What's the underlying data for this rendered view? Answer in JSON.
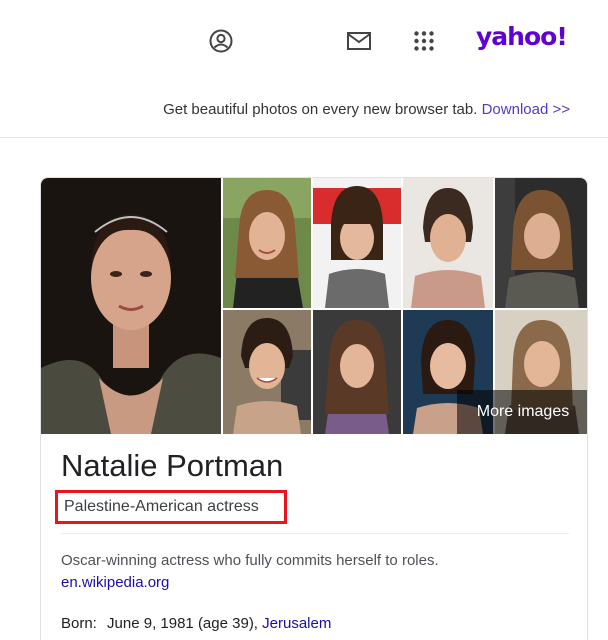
{
  "header": {
    "profile_icon": "profile-icon",
    "mail_icon": "mail-icon",
    "apps_icon": "apps-grid-icon",
    "logo_text": "yahoo!"
  },
  "promo": {
    "text": "Get beautiful photos on every new browser tab.",
    "link": "Download >>"
  },
  "knowledge_panel": {
    "more_images_label": "More images",
    "title": "Natalie Portman",
    "subtitle": "Palestine-American actress",
    "description": "Oscar-winning actress who fully commits herself to roles.",
    "source_link": "en.wikipedia.org",
    "born_label": "Born:",
    "born_value": "June 9, 1981 (age 39),",
    "born_place": "Jerusalem"
  },
  "colors": {
    "brand": "#6001d2",
    "link": "#1a0dab",
    "promo_link": "#4f3ec4",
    "highlight_border": "#e8141e"
  }
}
